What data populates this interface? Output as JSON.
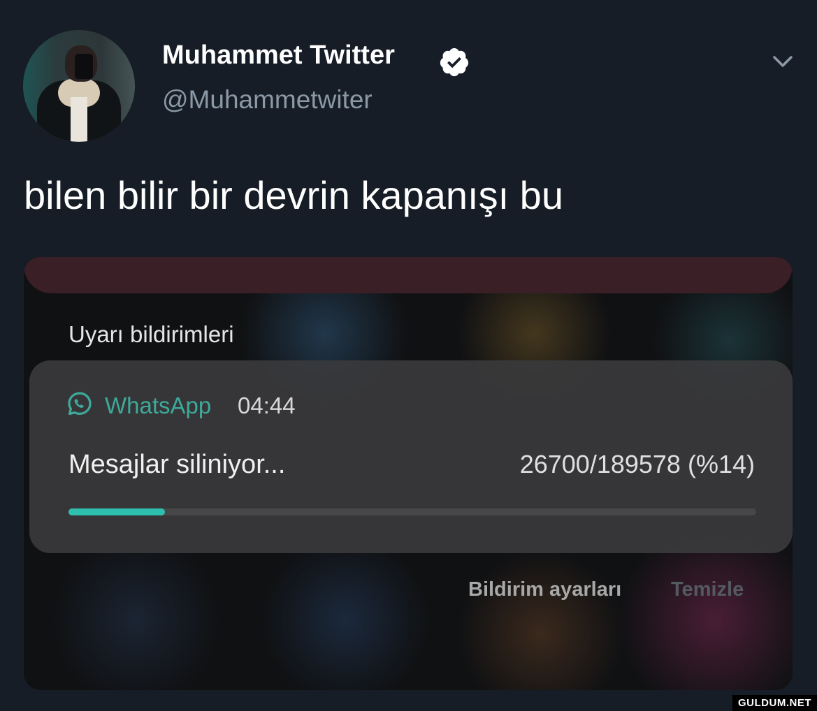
{
  "tweet": {
    "display_name": "Muhammet Twitter",
    "handle": "@Muhammetwiter",
    "text": "bilen bilir bir devrin kapanışı bu",
    "verified": true
  },
  "media": {
    "section_title": "Uyarı bildirimleri",
    "notification": {
      "app_name": "WhatsApp",
      "time": "04:44",
      "title": "Mesajlar siliniyor...",
      "progress_text": "26700/189578 (%14)",
      "progress_fraction": 0.14,
      "accent_color": "#2fbfae"
    },
    "actions": {
      "settings_label": "Bildirim ayarları",
      "clear_label": "Temizle"
    }
  },
  "watermark": "GULDUM.NET",
  "colors": {
    "background": "#161d26",
    "whatsapp_green": "#3ea99a",
    "secondary_text": "#8b98a5"
  },
  "icons": [
    "verified-badge-icon",
    "chevron-down-icon",
    "whatsapp-icon"
  ]
}
